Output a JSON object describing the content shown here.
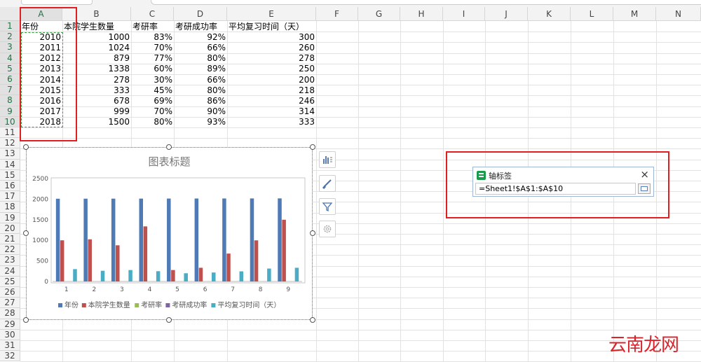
{
  "columns": [
    "A",
    "B",
    "C",
    "D",
    "E",
    "F",
    "G",
    "H",
    "I",
    "J",
    "K",
    "L",
    "M",
    "N"
  ],
  "rows": [
    "1",
    "2",
    "3",
    "4",
    "5",
    "6",
    "7",
    "8",
    "9",
    "10",
    "11",
    "12",
    "13",
    "14",
    "15",
    "16",
    "17",
    "18",
    "19",
    "20",
    "21",
    "22",
    "23",
    "24",
    "25",
    "26",
    "27",
    "28",
    "29",
    "30",
    "31",
    "32"
  ],
  "table": {
    "headers": [
      "年份",
      "本院学生数量",
      "考研率",
      "考研成功率",
      "平均复习时间（天）"
    ],
    "data": [
      [
        "2010",
        "1000",
        "83%",
        "92%",
        "300"
      ],
      [
        "2011",
        "1024",
        "70%",
        "66%",
        "260"
      ],
      [
        "2012",
        "879",
        "77%",
        "80%",
        "278"
      ],
      [
        "2013",
        "1338",
        "60%",
        "89%",
        "250"
      ],
      [
        "2014",
        "278",
        "30%",
        "66%",
        "200"
      ],
      [
        "2015",
        "333",
        "45%",
        "80%",
        "218"
      ],
      [
        "2016",
        "678",
        "69%",
        "86%",
        "246"
      ],
      [
        "2017",
        "999",
        "70%",
        "90%",
        "314"
      ],
      [
        "2018",
        "1500",
        "80%",
        "93%",
        "333"
      ]
    ]
  },
  "chart_data": {
    "type": "bar",
    "title": "图表标题",
    "categories": [
      "1",
      "2",
      "3",
      "4",
      "5",
      "6",
      "7",
      "8",
      "9"
    ],
    "ylim": [
      0,
      2500
    ],
    "yticks": [
      "0",
      "500",
      "1000",
      "1500",
      "2000",
      "2500"
    ],
    "grid": false,
    "legend": "bottom",
    "series": [
      {
        "name": "年份",
        "color": "#4e7ab5",
        "values": [
          2010,
          2011,
          2012,
          2013,
          2014,
          2015,
          2016,
          2017,
          2018
        ]
      },
      {
        "name": "本院学生数量",
        "color": "#c0504d",
        "values": [
          1000,
          1024,
          879,
          1338,
          278,
          333,
          678,
          999,
          1500
        ]
      },
      {
        "name": "考研率",
        "color": "#9bbb59",
        "values": [
          0.83,
          0.7,
          0.77,
          0.6,
          0.3,
          0.45,
          0.69,
          0.7,
          0.8
        ]
      },
      {
        "name": "考研成功率",
        "color": "#8064a2",
        "values": [
          0.92,
          0.66,
          0.8,
          0.89,
          0.66,
          0.8,
          0.86,
          0.9,
          0.93
        ]
      },
      {
        "name": "平均复习时间（天）",
        "color": "#4bacc6",
        "values": [
          300,
          260,
          278,
          250,
          200,
          218,
          246,
          314,
          333
        ]
      }
    ]
  },
  "dialog": {
    "title": "轴标签",
    "close": "×",
    "value": "=Sheet1!$A$1:$A$10"
  },
  "watermark": "云南龙网"
}
